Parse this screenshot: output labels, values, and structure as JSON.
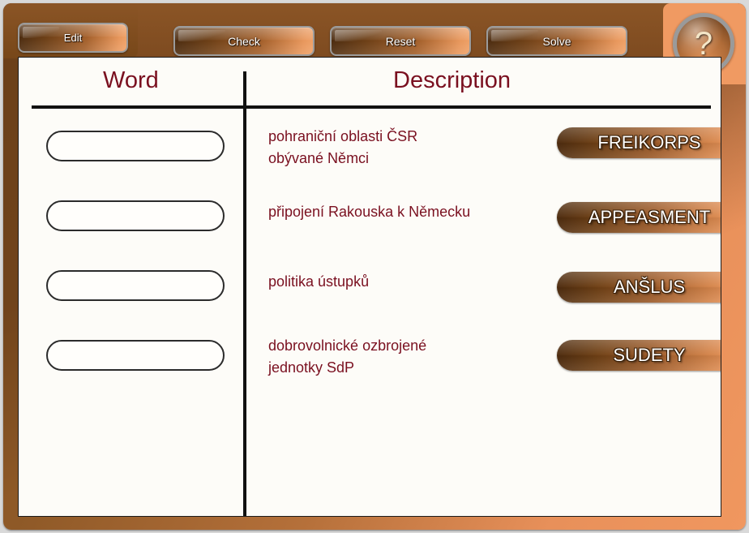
{
  "toolbar": {
    "edit_label": "Edit",
    "check_label": "Check",
    "reset_label": "Reset",
    "solve_label": "Solve",
    "help_label": "?"
  },
  "columns": {
    "word_heading": "Word",
    "description_heading": "Description"
  },
  "rows": [
    {
      "answer_value": "",
      "answer_placeholder": "",
      "description": "pohraniční oblasti ČSR\nobývané Němci",
      "word_bank": "FREIKORPS"
    },
    {
      "answer_value": "",
      "answer_placeholder": "",
      "description": "připojení Rakouska k Německu",
      "word_bank": "APPEASMENT"
    },
    {
      "answer_value": "",
      "answer_placeholder": "",
      "description": "politika ústupků",
      "word_bank": "ANŠLUS"
    },
    {
      "answer_value": "",
      "answer_placeholder": "",
      "description": "dobrovolnické ozbrojené\njednotky SdP",
      "word_bank": "SUDETY"
    }
  ],
  "colors": {
    "frame_brown": "#8a5524",
    "frame_orange": "#f09a62",
    "heading_maroon": "#7a1020",
    "panel_background": "#fdfcf8",
    "rule_black": "#111111"
  }
}
